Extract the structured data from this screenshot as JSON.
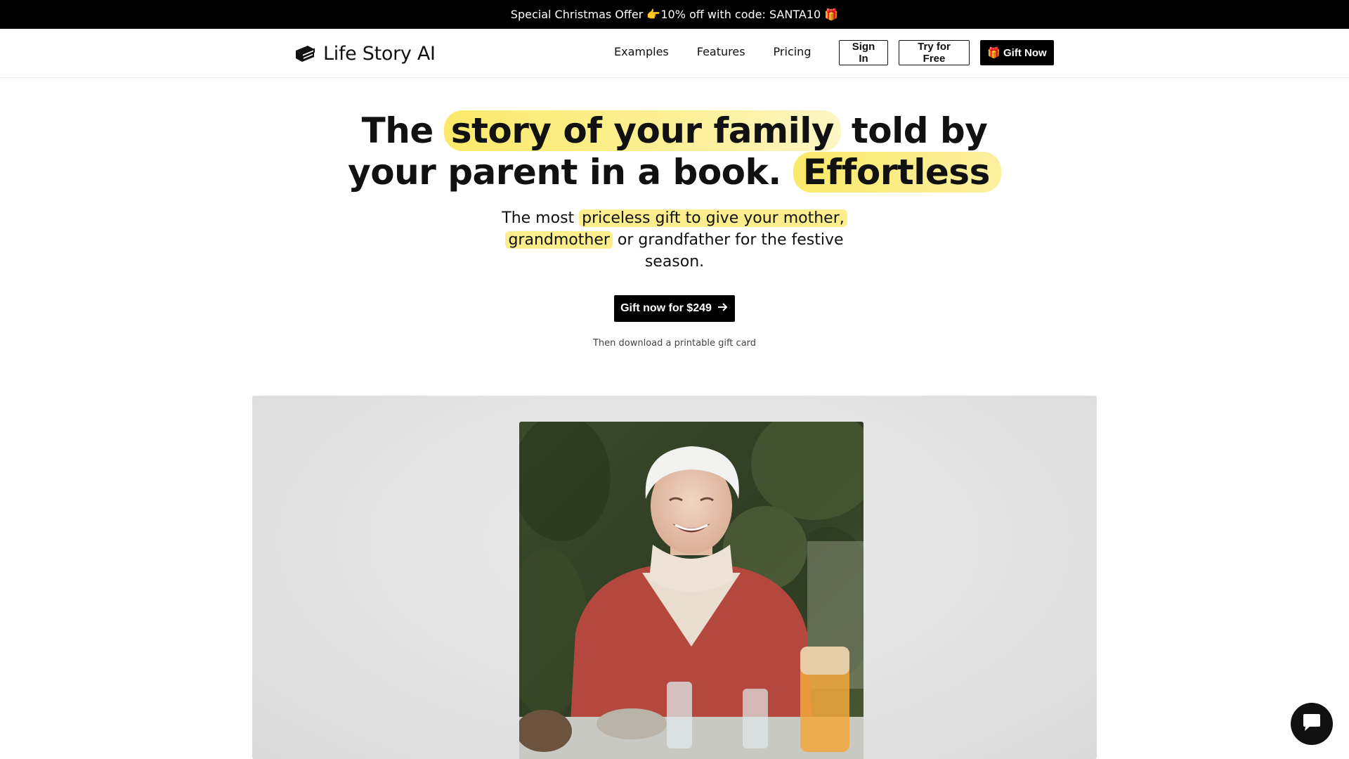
{
  "promo": {
    "text": "Special Christmas Offer 👉10% off with code: SANTA10 🎁"
  },
  "header": {
    "brand": "Life Story AI",
    "nav": [
      "Examples",
      "Features",
      "Pricing"
    ],
    "sign_in": "Sign In",
    "try_free": "Try for Free",
    "gift_now_emoji": "🎁",
    "gift_now": "Gift Now"
  },
  "hero": {
    "title_parts": [
      "The ",
      "story of your family",
      " told by your parent in a book. ",
      "Effortless"
    ],
    "subtitle_parts": [
      "The most ",
      "priceless gift to give your mother, grandmother",
      " or grandfather for the festive season."
    ],
    "cta_label": "Gift now for $249",
    "cta_note": "Then download a printable gift card"
  },
  "colors": {
    "highlight": "#fbe96a",
    "primary": "#000000"
  }
}
